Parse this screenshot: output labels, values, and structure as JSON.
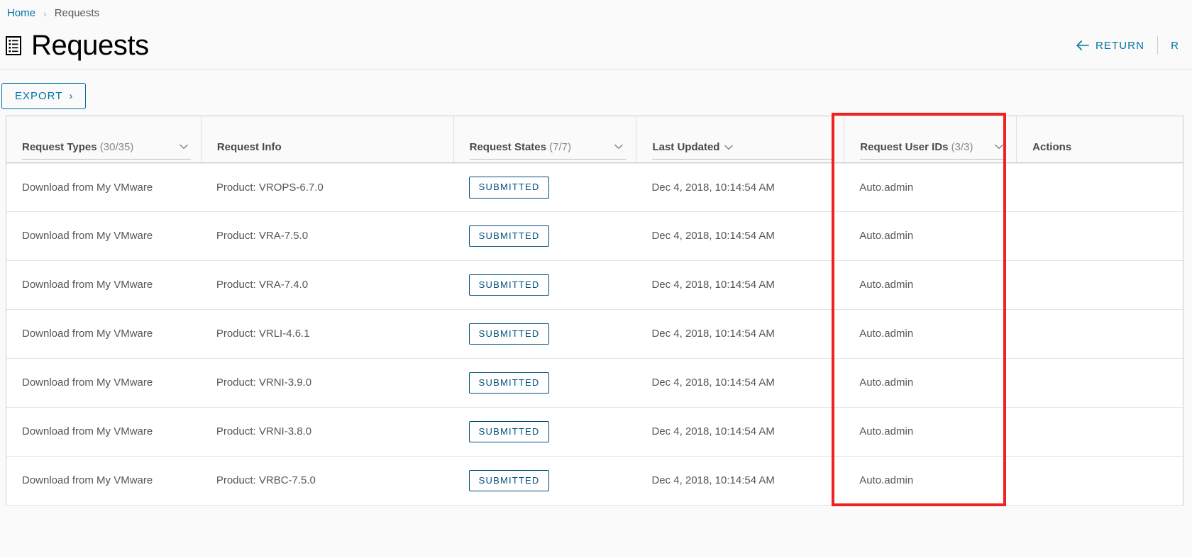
{
  "breadcrumb": {
    "home_label": "Home",
    "separator": "›",
    "current_label": "Requests"
  },
  "header": {
    "title": "Requests",
    "icon": "document-list-icon",
    "return_label": "RETURN",
    "secondary_label": "R",
    "link_color": "#0072a3"
  },
  "toolbar": {
    "export_label": "EXPORT",
    "export_chevron": "›",
    "border_color": "#0072a3"
  },
  "table": {
    "columns": [
      {
        "label": "Request Types",
        "count": "(30/35)",
        "filterable": true,
        "sortable": false
      },
      {
        "label": "Request Info",
        "count": "",
        "filterable": false,
        "sortable": false
      },
      {
        "label": "Request States",
        "count": "(7/7)",
        "filterable": true,
        "sortable": false
      },
      {
        "label": "Last Updated",
        "count": "",
        "filterable": false,
        "sortable": true
      },
      {
        "label": "Request User IDs",
        "count": "(3/3)",
        "filterable": true,
        "sortable": false
      },
      {
        "label": "Actions",
        "count": "",
        "filterable": false,
        "sortable": false
      }
    ],
    "rows": [
      {
        "type": "Download from My VMware",
        "info": "Product: VROPS-6.7.0",
        "state": "SUBMITTED",
        "updated": "Dec 4, 2018, 10:14:54 AM",
        "user": "Auto.admin",
        "actions": ""
      },
      {
        "type": "Download from My VMware",
        "info": "Product: VRA-7.5.0",
        "state": "SUBMITTED",
        "updated": "Dec 4, 2018, 10:14:54 AM",
        "user": "Auto.admin",
        "actions": ""
      },
      {
        "type": "Download from My VMware",
        "info": "Product: VRA-7.4.0",
        "state": "SUBMITTED",
        "updated": "Dec 4, 2018, 10:14:54 AM",
        "user": "Auto.admin",
        "actions": ""
      },
      {
        "type": "Download from My VMware",
        "info": "Product: VRLI-4.6.1",
        "state": "SUBMITTED",
        "updated": "Dec 4, 2018, 10:14:54 AM",
        "user": "Auto.admin",
        "actions": ""
      },
      {
        "type": "Download from My VMware",
        "info": "Product: VRNI-3.9.0",
        "state": "SUBMITTED",
        "updated": "Dec 4, 2018, 10:14:54 AM",
        "user": "Auto.admin",
        "actions": ""
      },
      {
        "type": "Download from My VMware",
        "info": "Product: VRNI-3.8.0",
        "state": "SUBMITTED",
        "updated": "Dec 4, 2018, 10:14:54 AM",
        "user": "Auto.admin",
        "actions": ""
      },
      {
        "type": "Download from My VMware",
        "info": "Product: VRBC-7.5.0",
        "state": "SUBMITTED",
        "updated": "Dec 4, 2018, 10:14:54 AM",
        "user": "Auto.admin",
        "actions": ""
      }
    ],
    "badge_color": "#014f7a"
  },
  "annotation": {
    "shape": "rectangle",
    "color": "#ee2222",
    "target_column": "Request User IDs"
  }
}
